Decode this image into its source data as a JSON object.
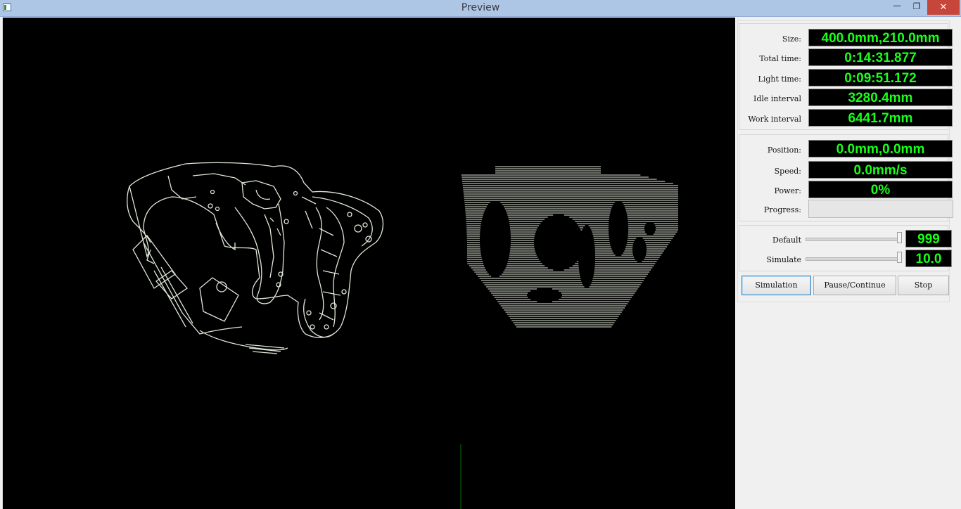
{
  "window": {
    "title": "Preview",
    "controls": {
      "minimize": "—",
      "maximize": "❐",
      "close": "✕"
    }
  },
  "stats": {
    "size": {
      "label": "Size:",
      "value": "400.0mm,210.0mm"
    },
    "total_time": {
      "label": "Total time:",
      "value": "0:14:31.877"
    },
    "light_time": {
      "label": "Light time:",
      "value": "0:09:51.172"
    },
    "idle_interval": {
      "label": "Idle interval",
      "value": "3280.4mm"
    },
    "work_interval": {
      "label": "Work interval",
      "value": "6441.7mm"
    }
  },
  "status": {
    "position": {
      "label": "Position:",
      "value": "0.0mm,0.0mm"
    },
    "speed": {
      "label": "Speed:",
      "value": "0.0mm/s"
    },
    "power": {
      "label": "Power:",
      "value": "0%"
    },
    "progress": {
      "label": "Progress:",
      "fraction": 0
    }
  },
  "sliders": {
    "default": {
      "label": "Default",
      "value": "999"
    },
    "simulate": {
      "label": "Simulate",
      "value": "10.0"
    }
  },
  "buttons": {
    "simulation": "Simulation",
    "pause_continue": "Pause/Continue",
    "stop": "Stop"
  },
  "colors": {
    "display_green": "#19ff19",
    "outline": "#dfe8d8",
    "canvas": "#000000",
    "cursor_line": "#0a6b0a"
  }
}
